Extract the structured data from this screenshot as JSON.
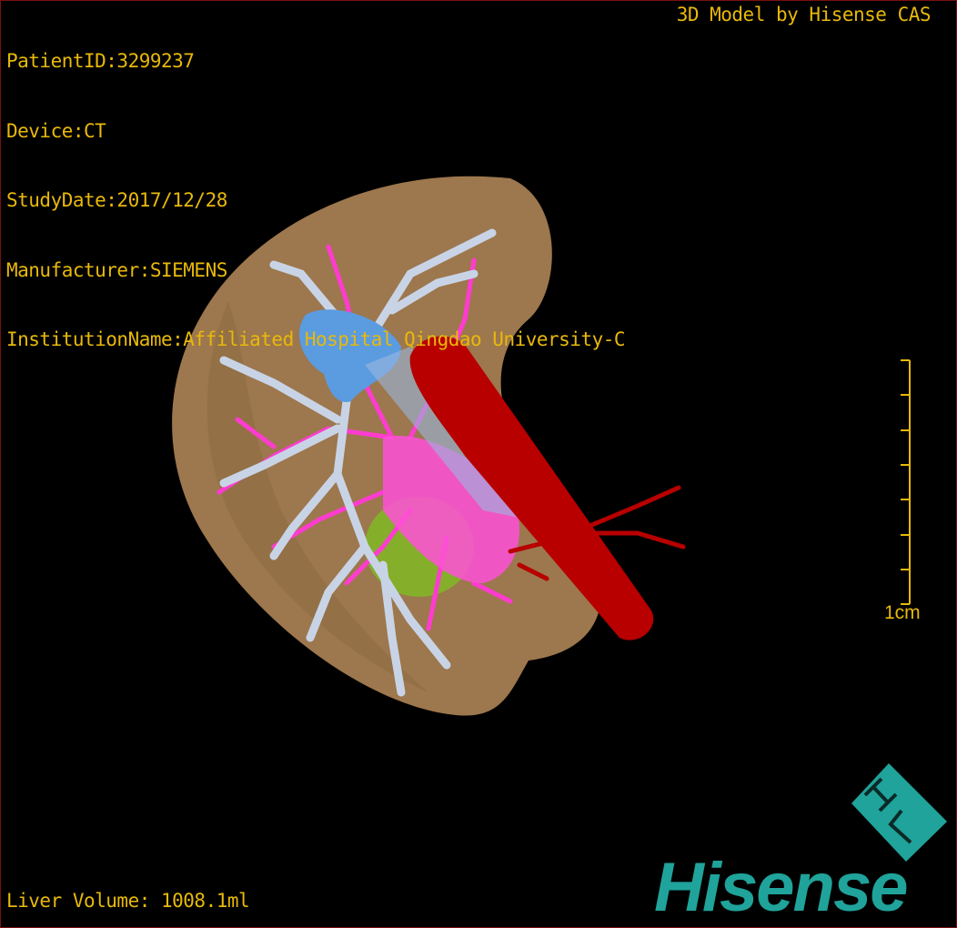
{
  "overlay": {
    "patient_id": "PatientID:3299237",
    "device": "Device:CT",
    "study_date": "StudyDate:2017/12/28",
    "manufacturer": "Manufacturer:SIEMENS",
    "institution": "InstitutionName:Affiliated Hospital Qingdao University-C"
  },
  "brand_caption": "3D Model by Hisense CAS",
  "liver_volume": "Liver Volume: 1008.1ml",
  "scale_bar": {
    "label": "1cm",
    "ticks": 8
  },
  "logo": {
    "word": "Hisense",
    "badge": "HL"
  },
  "colors": {
    "text": "#e8b90a",
    "liver": "#b88c5a",
    "portal_vein": "#c8d4e6",
    "hepatic_vein": "#ff3ccf",
    "ivc_blue": "#5b9be0",
    "artery_red": "#b80000",
    "lesion": "#7ec020",
    "logo_teal": "#1fa39a",
    "border": "#7a1010"
  }
}
